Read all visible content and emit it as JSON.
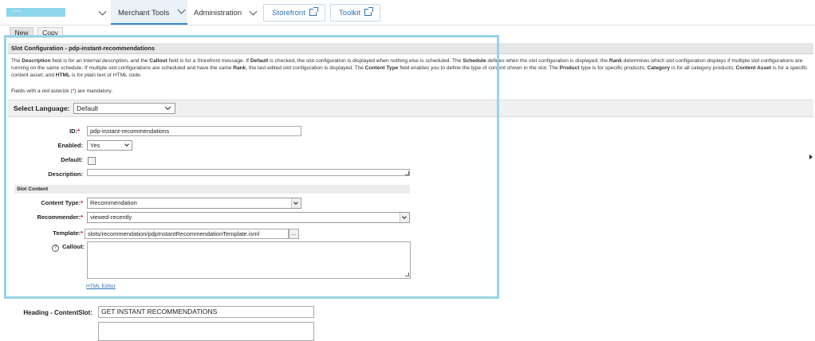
{
  "nav": {
    "site_selector": "-----",
    "merchant_tools": "Merchant Tools",
    "administration": "Administration",
    "storefront": "Storefront",
    "toolkit": "Toolkit"
  },
  "tabs": {
    "new": "New",
    "copy": "Copy"
  },
  "panel": {
    "title": "Slot Configuration - pdp-instant-recommendations",
    "description_segments": [
      {
        "t": "The ",
        "b": false
      },
      {
        "t": "Description",
        "b": true
      },
      {
        "t": " field is for an internal description, and the ",
        "b": false
      },
      {
        "t": "Callout",
        "b": true
      },
      {
        "t": " field is for a Storefront message. If ",
        "b": false
      },
      {
        "t": "Default",
        "b": true
      },
      {
        "t": " is checked, the slot configuration is displayed when nothing else is scheduled. The ",
        "b": false
      },
      {
        "t": "Schedule",
        "b": true
      },
      {
        "t": " defines when the slot configuration is displayed; the ",
        "b": false
      },
      {
        "t": "Rank",
        "b": true
      },
      {
        "t": " determines which slot configuration displays if multiple slot configurations are running on the same schedule. If multiple slot configurations are scheduled and have the same ",
        "b": false
      },
      {
        "t": "Rank",
        "b": true
      },
      {
        "t": ", the last edited slot configuration is displayed. The ",
        "b": false
      },
      {
        "t": "Content Type",
        "b": true
      },
      {
        "t": " field enables you to define the type of content shown in the slot. The ",
        "b": false
      },
      {
        "t": "Product",
        "b": true
      },
      {
        "t": " type is for specific products; ",
        "b": false
      },
      {
        "t": "Category",
        "b": true
      },
      {
        "t": " is for all category products; ",
        "b": false
      },
      {
        "t": "Content Asset",
        "b": true
      },
      {
        "t": " is for a specific content asset; and ",
        "b": false
      },
      {
        "t": "HTML",
        "b": true
      },
      {
        "t": " is for plain text or HTML code.",
        "b": false
      }
    ],
    "mandatory_pre": "Fields with a red asterisk (",
    "mandatory_star": "*",
    "mandatory_post": ") are mandatory."
  },
  "language": {
    "label": "Select Language:",
    "value": "Default"
  },
  "form": {
    "id_label": "ID:",
    "id_value": "pdp-instant-recommendations",
    "enabled_label": "Enabled:",
    "enabled_value": "Yes",
    "default_label": "Default:",
    "default_checked": false,
    "description_label": "Description:",
    "description_value": "",
    "slot_content_label": "Slot Content",
    "content_type_label": "Content Type:",
    "content_type_value": "Recommendation",
    "recommender_label": "Recommender:",
    "recommender_value": "viewed-recently",
    "template_label": "Template:",
    "template_value": "slots/recommendation/pdpInstantRecommendationTemplate.isml",
    "template_browse": "...",
    "callout_label": "Callout:",
    "callout_value": "",
    "html_editor_link": "HTML Editor",
    "star": "*"
  },
  "content_slot": {
    "heading_label": "Heading - ContentSlot:",
    "heading_value": "GET INSTANT RECOMMENDATIONS"
  },
  "colors": {
    "accent": "#2e74b5",
    "highlight": "#99d3e3",
    "required": "#d0021b"
  }
}
